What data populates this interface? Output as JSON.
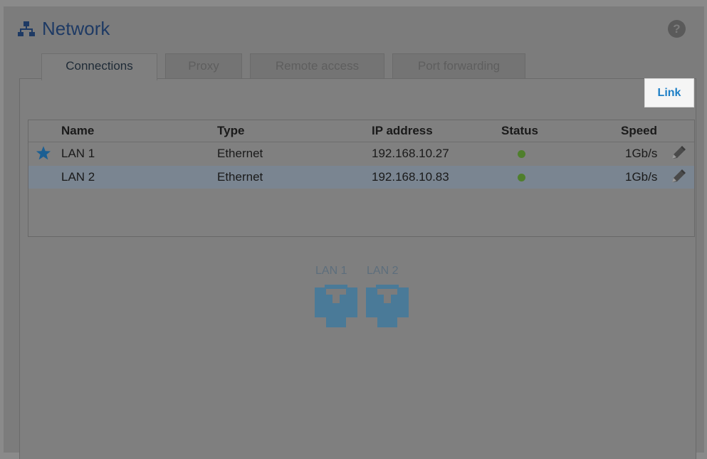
{
  "page": {
    "title": "Network",
    "title_icon": "network-icon",
    "help_icon": "help-icon",
    "help_glyph": "?"
  },
  "tabs": [
    {
      "label": "Connections",
      "active": true
    },
    {
      "label": "Proxy",
      "active": false
    },
    {
      "label": "Remote access",
      "active": false
    },
    {
      "label": "Port forwarding",
      "active": false
    }
  ],
  "toolbar": {
    "link_label": "Link"
  },
  "table": {
    "columns": {
      "name": "Name",
      "type": "Type",
      "ip": "IP address",
      "status": "Status",
      "speed": "Speed"
    },
    "rows": [
      {
        "name": "LAN 1",
        "type": "Ethernet",
        "ip": "192.168.10.27",
        "status": "connected",
        "speed": "1Gb/s",
        "default": true,
        "selected": false
      },
      {
        "name": "LAN 2",
        "type": "Ethernet",
        "ip": "192.168.10.83",
        "status": "connected",
        "speed": "1Gb/s",
        "default": false,
        "selected": true
      }
    ]
  },
  "ports": [
    {
      "label": "LAN 1",
      "icon": "ethernet-port-icon"
    },
    {
      "label": "LAN 2",
      "icon": "ethernet-port-icon"
    }
  ],
  "colors": {
    "accent": "#1d7fc6",
    "status_ok": "#4f7f2c",
    "port_blue": "#4a7a98",
    "title_blue": "#1e3a64"
  }
}
